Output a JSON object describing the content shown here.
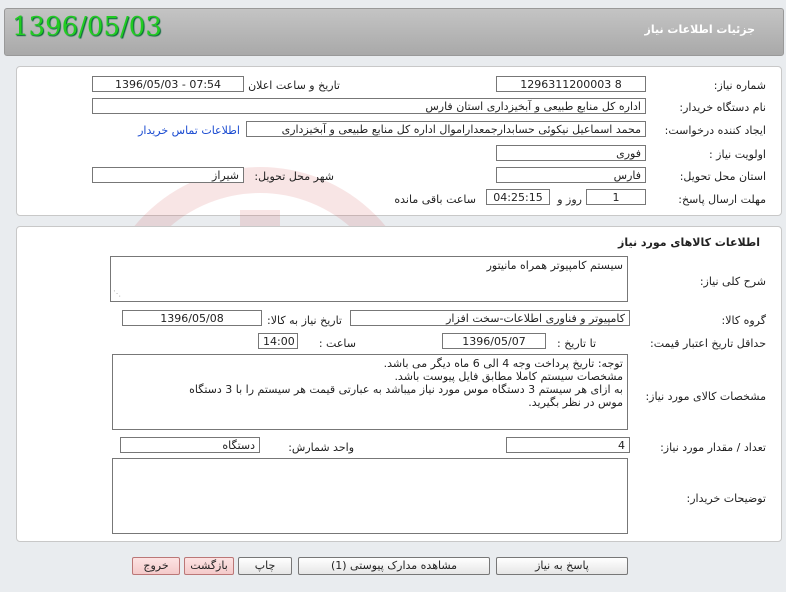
{
  "header": {
    "title": "جزئیات اطلاعات نیاز",
    "date_overlay": "1396/05/03"
  },
  "info": {
    "need_no_label": "شماره نیاز:",
    "need_no": "1296311200003 8",
    "announce_label": "تاریخ و ساعت اعلان عمومی:",
    "announce_value": "1396/05/03 - 07:54",
    "buyer_label": "نام دستگاه خریدار:",
    "buyer_value": "اداره کل منابع طبیعی و آبخیزداری استان فارس",
    "creator_label": "ایجاد کننده درخواست:",
    "creator_value": "محمد اسماعیل نیکوئی حسابدارجمعداراموال اداره کل منابع طبیعی و آبخیزداری",
    "contact_link": "اطلاعات تماس خریدار",
    "priority_label": "اولویت نیاز :",
    "priority_value": "فوری",
    "province_label": "استان محل تحویل:",
    "province_value": "فارس",
    "city_label": "شهر محل تحویل:",
    "city_value": "شیراز",
    "deadline_label": "مهلت ارسال پاسخ:",
    "deadline_days": "1",
    "days_word": "روز و",
    "deadline_time": "04:25:15",
    "remaining_word": "ساعت باقی مانده"
  },
  "goods": {
    "section_title": "اطلاعات کالاهای مورد نیاز",
    "desc_label": "شرح کلی نیاز:",
    "desc_value": "سیستم کامپیوتر همراه مانیتور",
    "group_label": "گروه کالا:",
    "group_value": "کامپیوتر و فناوری اطلاعات-سخت افزار",
    "need_date_label": "تاریخ نیاز به کالا:",
    "need_date_value": "1396/05/08",
    "validity_label": "حداقل تاریخ اعتبار قیمت:",
    "until_label": "تا تاریخ :",
    "validity_date": "1396/05/07",
    "hour_label": "ساعت :",
    "validity_hour": "14:00",
    "spec_label": "مشخصات کالای مورد نیاز:",
    "spec_lines": [
      "توجه: تاریخ پرداخت وجه 4 الی 6 ماه دیگر می باشد.",
      "مشخصات سیستم کاملا مطابق فایل پیوست باشد.",
      "به ازای هر سیستم 3 دستگاه موس مورد نیاز میباشد به عبارتی قیمت هر سیستم را با 3 دستگاه",
      "موس در نظر بگیرید."
    ],
    "qty_label": "تعداد / مقدار مورد نیاز:",
    "qty_value": "4",
    "unit_label": "واحد شمارش:",
    "unit_value": "دستگاه",
    "buyer_notes_label": "توضیحات خریدار:",
    "buyer_notes_value": ""
  },
  "buttons": {
    "reply": "پاسخ به نیاز",
    "attachments": "مشاهده مدارک پیوستی (1)",
    "print": "چاپ",
    "back": "بازگشت",
    "exit": "خروج"
  },
  "colors": {
    "date_overlay": "#22cc22",
    "link": "#1a4bd1",
    "header": "#b5b5b5"
  }
}
